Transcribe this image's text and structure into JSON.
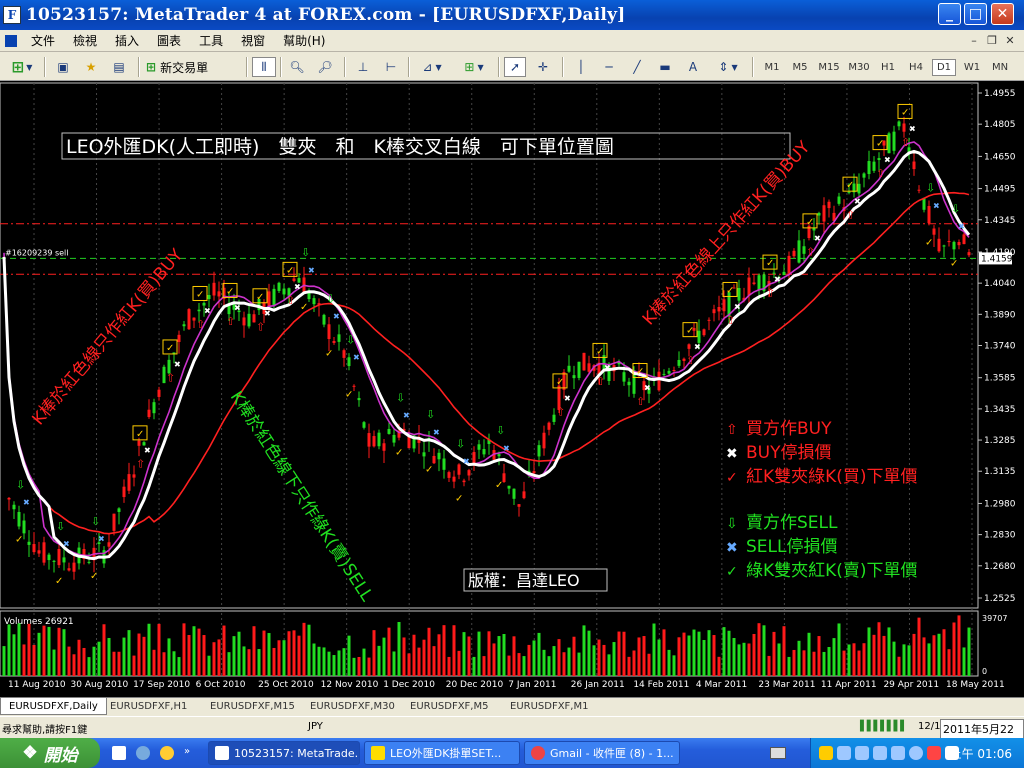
{
  "window": {
    "title": "10523157: MetaTrader 4 at FOREX.com - [EURUSDFXF,Daily]"
  },
  "menu": [
    "文件",
    "檢視",
    "插入",
    "圖表",
    "工具",
    "視窗",
    "幫助(H)"
  ],
  "toolbar": {
    "new_order": "新交易單"
  },
  "timeframes": [
    "M1",
    "M5",
    "M15",
    "M30",
    "H1",
    "H4",
    "D1",
    "W1",
    "MN"
  ],
  "active_timeframe": "D1",
  "chart": {
    "banner": "LEO外匯DK(人工即時)　雙夾　和　K棒交叉白線　可下單位置圖",
    "copyright": "版權：昌達LEO",
    "order_label": "#16209239 sell",
    "current_price": "1.4159",
    "volume_label": "Volumes 26921",
    "volume_max": "39707",
    "volume_min": "0",
    "diag_text": {
      "left_buy": "K棒於紅色線只作紅K(買)BUY",
      "middle_sell": "K棒於紅色線下只作綠K(賣)SELL",
      "right_buy": "K棒於紅色線上只作紅K(買)BUY"
    },
    "legend": [
      {
        "symbol": "⇧",
        "text": "買方作BUY",
        "color": "#ff2020"
      },
      {
        "symbol": "✖",
        "text": "BUY停損價",
        "color": "#ff2020"
      },
      {
        "symbol": "✓",
        "text": "紅K雙夾綠K(買)下單價",
        "color": "#ff2020"
      },
      {
        "symbol": "⇩",
        "text": "賣方作SELL",
        "color": "#20e020"
      },
      {
        "symbol": "✖",
        "text": "SELL停損價",
        "color": "#20e020"
      },
      {
        "symbol": "✓",
        "text": "綠K雙夾紅K(賣)下單價",
        "color": "#20e020"
      }
    ],
    "price_ticks": [
      "1.4955",
      "1.4805",
      "1.4650",
      "1.4495",
      "1.4345",
      "1.4190",
      "1.4040",
      "1.3890",
      "1.3740",
      "1.3585",
      "1.3435",
      "1.3285",
      "1.3135",
      "1.2980",
      "1.2830",
      "1.2680",
      "1.2525"
    ],
    "date_ticks": [
      "11 Aug 2010",
      "30 Aug 2010",
      "17 Sep 2010",
      "6 Oct 2010",
      "25 Oct 2010",
      "12 Nov 2010",
      "1 Dec 2010",
      "20 Dec 2010",
      "7 Jan 2011",
      "26 Jan 2011",
      "14 Feb 2011",
      "4 Mar 2011",
      "23 Mar 2011",
      "11 Apr 2011",
      "29 Apr 2011",
      "18 May 2011"
    ],
    "colors": {
      "bull": "#ff1a1a",
      "bear": "#22dd22",
      "ma_slow": "#ff2020",
      "ma_mid": "#ffffff",
      "ma_fast": "#cc33cc",
      "grid": "#555555"
    }
  },
  "chart_tabs": [
    "EURUSDFXF,Daily",
    "EURUSDFXF,H1",
    "EURUSDFXF,M15",
    "EURUSDFXF,M30",
    "EURUSDFXF,M5",
    "EURUSDFXF,M1"
  ],
  "status": {
    "help": "尋求幫助,請按F1鍵",
    "currency": "JPY",
    "traffic": "12/1",
    "date": "2011年5月22日"
  },
  "taskbar": {
    "start": "開始",
    "tasks": [
      "10523157: MetaTrade...",
      "LEO外匯DK掛單SET...",
      "Gmail - 收件匣 (8) - 1..."
    ],
    "clock": "上午 01:06"
  }
}
